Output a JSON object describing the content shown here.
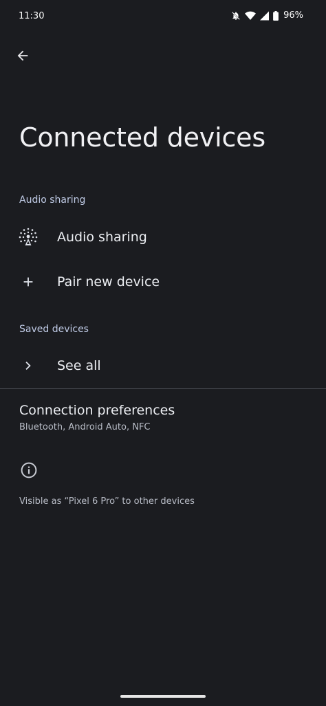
{
  "status_bar": {
    "time": "11:30",
    "battery_percent": "96%",
    "icons": [
      "mute-icon",
      "wifi-icon",
      "signal-icon",
      "battery-icon"
    ]
  },
  "header": {
    "back_icon": "arrow-back-icon",
    "title": "Connected devices"
  },
  "sections": {
    "audio_sharing_header": "Audio sharing",
    "audio_sharing_item": "Audio sharing",
    "pair_new_device": "Pair new device",
    "saved_devices_header": "Saved devices",
    "see_all": "See all"
  },
  "connection_preferences": {
    "title": "Connection preferences",
    "summary": "Bluetooth, Android Auto, NFC"
  },
  "footer": {
    "info_icon": "info-icon",
    "visibility_text": "Visible as “Pixel 6 Pro” to other devices"
  },
  "colors": {
    "background": "#1b1c20",
    "section_header": "#c0cbe6",
    "text_primary": "#eceef2",
    "text_secondary": "#b8bcc6"
  }
}
